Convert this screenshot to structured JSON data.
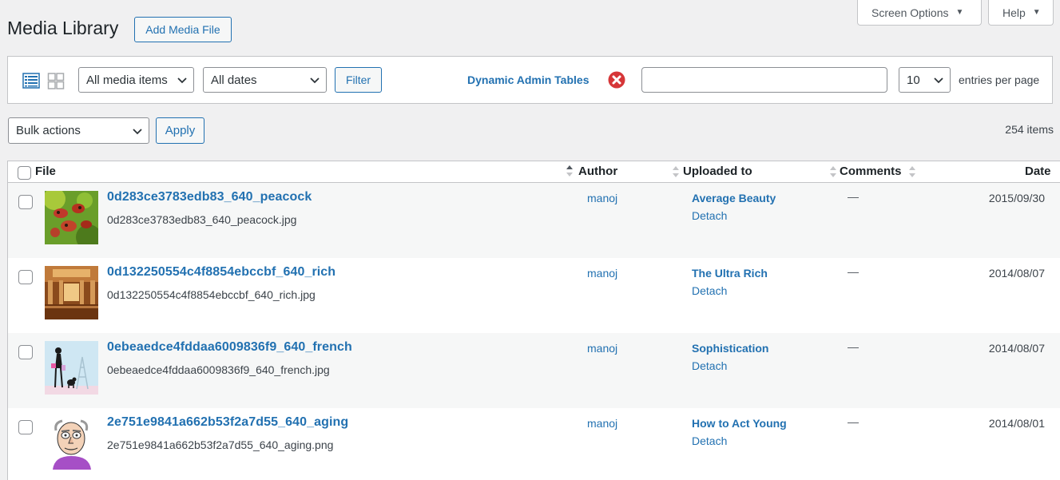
{
  "header": {
    "title": "Media Library",
    "add_button": "Add Media File",
    "screen_options": "Screen Options",
    "help": "Help"
  },
  "filters": {
    "media_type": "All media items",
    "dates": "All dates",
    "filter_button": "Filter",
    "dat_link": "Dynamic Admin Tables",
    "search_value": "",
    "entries_value": "10",
    "entries_label": "entries per page"
  },
  "bulk": {
    "select_value": "Bulk actions",
    "apply_button": "Apply",
    "item_count": "254 items"
  },
  "table": {
    "columns": {
      "file": "File",
      "author": "Author",
      "uploaded_to": "Uploaded to",
      "comments": "Comments",
      "date": "Date"
    },
    "rows": [
      {
        "title": "0d283ce3783edb83_640_peacock",
        "filename": "0d283ce3783edb83_640_peacock.jpg",
        "author": "manoj",
        "uploaded_to": "Average Beauty",
        "detach": "Detach",
        "comments": "—",
        "date": "2015/09/30",
        "thumb": "butterflies-thumb"
      },
      {
        "title": "0d132250554c4f8854ebccbf_640_rich",
        "filename": "0d132250554c4f8854ebccbf_640_rich.jpg",
        "author": "manoj",
        "uploaded_to": "The Ultra Rich",
        "detach": "Detach",
        "comments": "—",
        "date": "2014/08/07",
        "thumb": "ballroom-thumb"
      },
      {
        "title": "0ebeaedce4fddaa6009836f9_640_french",
        "filename": "0ebeaedce4fddaa6009836f9_640_french.jpg",
        "author": "manoj",
        "uploaded_to": "Sophistication",
        "detach": "Detach",
        "comments": "—",
        "date": "2014/08/07",
        "thumb": "french-lady-thumb"
      },
      {
        "title": "2e751e9841a662b53f2a7d55_640_aging",
        "filename": "2e751e9841a662b53f2a7d55_640_aging.png",
        "author": "manoj",
        "uploaded_to": "How to Act Young",
        "detach": "Detach",
        "comments": "—",
        "date": "2014/08/01",
        "thumb": "old-man-thumb"
      }
    ]
  },
  "colors": {
    "link": "#2271b1",
    "background": "#f0f0f1",
    "close_icon": "#d63638"
  }
}
